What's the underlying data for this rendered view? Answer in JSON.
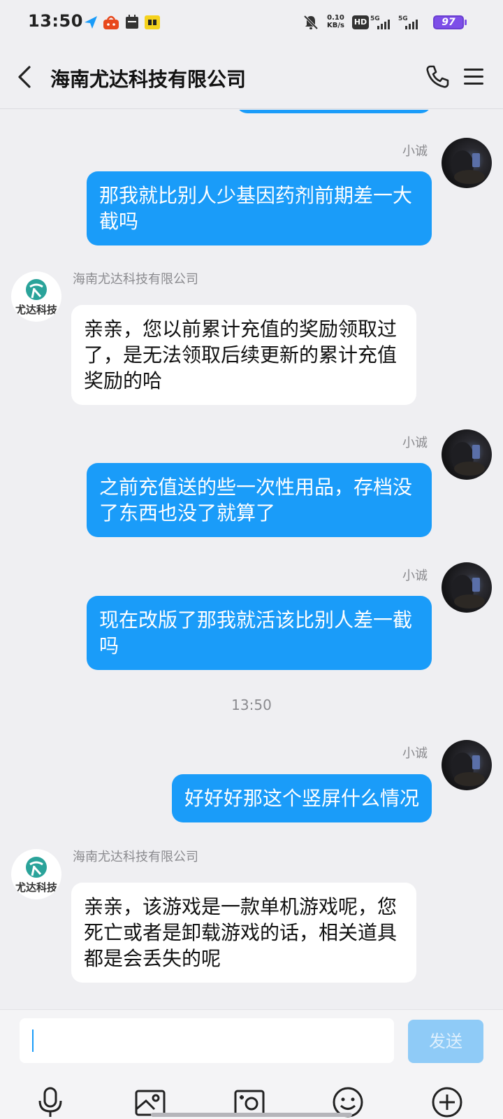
{
  "status_bar": {
    "time": "13:50",
    "speed_value": "0.10",
    "speed_unit": "KB/s",
    "hd": "HD",
    "battery": "97",
    "icons": [
      "bell-off-icon",
      "hd-icon",
      "signal-5g-icon",
      "signal-5g-icon",
      "battery-icon"
    ]
  },
  "header": {
    "title": "海南尤达科技有限公司",
    "icons": [
      "back-icon",
      "phone-icon",
      "menu-icon"
    ]
  },
  "company": {
    "logo_text": "尤达科技"
  },
  "messages": [
    {
      "direction": "out",
      "sender": "小诚",
      "text": "那我就比别人少基因药剂前期差一大截吗"
    },
    {
      "direction": "in",
      "sender": "海南尤达科技有限公司",
      "text": "亲亲，您以前累计充值的奖励领取过了，是无法领取后续更新的累计充值奖励的哈"
    },
    {
      "direction": "out",
      "sender": "小诚",
      "text": "之前充值送的些一次性用品，存档没了东西也没了就算了"
    },
    {
      "direction": "out",
      "sender": "小诚",
      "text": "现在改版了那我就活该比别人差一截吗"
    },
    {
      "direction": "out",
      "sender": "小诚",
      "text": "好好好那这个竖屏什么情况"
    },
    {
      "direction": "in",
      "sender": "海南尤达科技有限公司",
      "text": "亲亲，该游戏是一款单机游戏呢，您死亡或者是卸载游戏的话，相关道具都是会丢失的呢"
    }
  ],
  "time_divider": "13:50",
  "input": {
    "value": "",
    "send_label": "发送"
  },
  "toolbar": [
    "mic-icon",
    "image-icon",
    "camera-icon",
    "emoji-icon",
    "plus-icon"
  ],
  "colors": {
    "outgoing_bubble": "#1a9cf9",
    "incoming_bubble": "#ffffff",
    "background": "#efeff2",
    "send_button": "#8fcbf7",
    "logo_teal": "#2aa39a"
  }
}
